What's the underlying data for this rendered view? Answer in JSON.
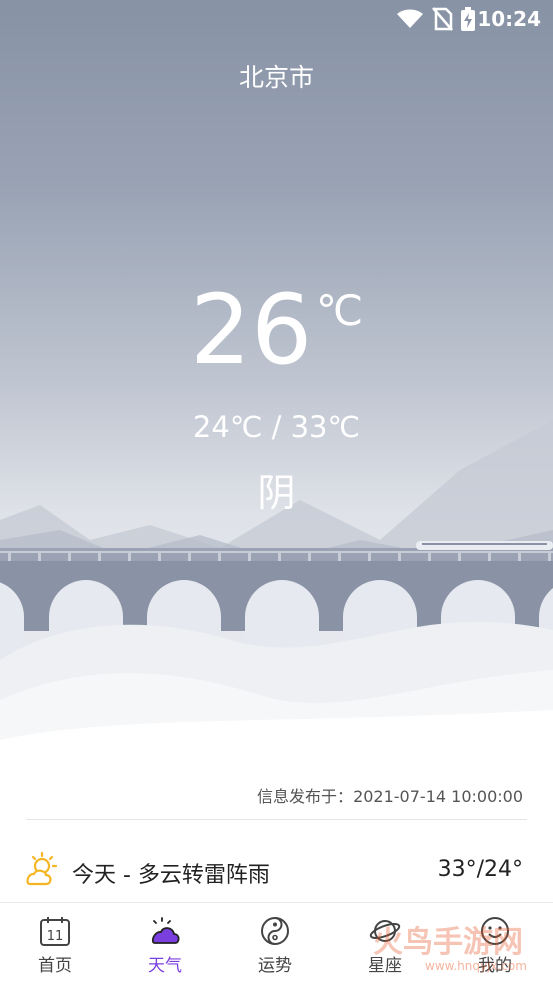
{
  "status_bar": {
    "time": "10:24",
    "icons": [
      "wifi-icon",
      "no-sim-icon",
      "battery-charging-icon"
    ]
  },
  "location": {
    "city": "北京市"
  },
  "current": {
    "temp": "26",
    "unit": "℃",
    "range": "24℃ / 33℃",
    "condition": "阴"
  },
  "publish": {
    "label": "信息发布于：",
    "time": "2021-07-14 10:00:00"
  },
  "forecast": {
    "icon": "partly-cloudy-icon",
    "text": "今天 - 多云转雷阵雨",
    "temps": "33°/24°"
  },
  "tabs": [
    {
      "label": "首页",
      "icon": "calendar-icon",
      "active": false,
      "calendar_day": "11"
    },
    {
      "label": "天气",
      "icon": "weather-cloud-icon",
      "active": true
    },
    {
      "label": "运势",
      "icon": "yin-yang-icon",
      "active": false
    },
    {
      "label": "星座",
      "icon": "planet-icon",
      "active": false
    },
    {
      "label": "我的",
      "icon": "smile-icon",
      "active": false
    }
  ],
  "colors": {
    "accent": "#7b3fe0",
    "hero_top": "#8792a5",
    "bridge": "#8a93a6",
    "sun": "#f5b623"
  },
  "watermark": {
    "text": "火鸟手游网",
    "url": "www.hnqyjx.com"
  }
}
